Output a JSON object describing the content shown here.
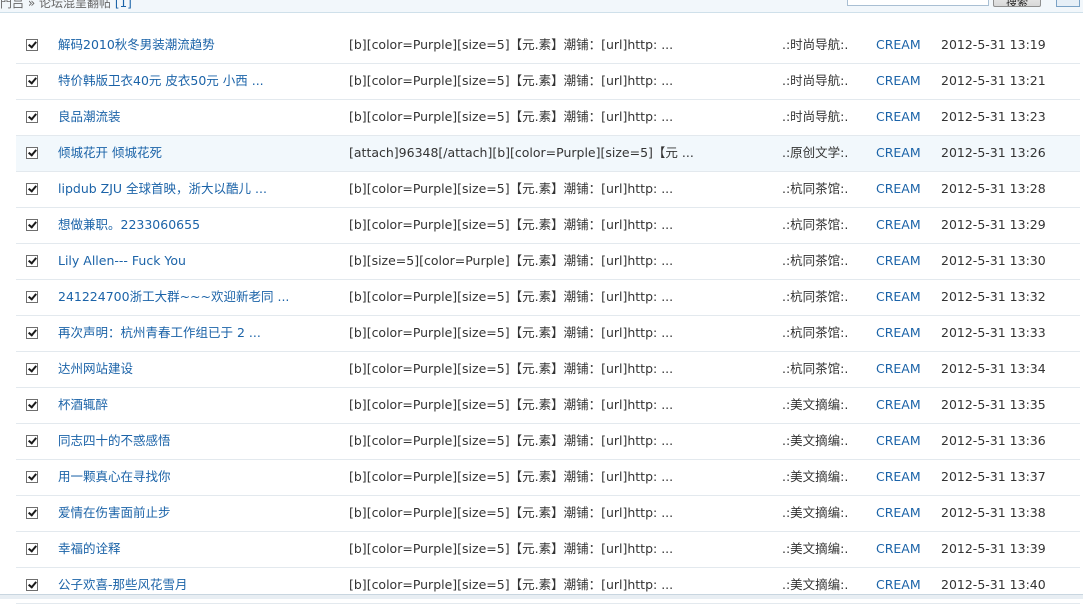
{
  "header": {
    "breadcrumb": "門吕 » 论坛混呈翻帖",
    "count_label": "[1]",
    "search_placeholder": "",
    "search_button": "搜索"
  },
  "posts": [
    {
      "title": "解码2010秋冬男装潮流趋势",
      "content": "[b][color=Purple][size=5]【元.素】潮铺：[url]http: ...",
      "forum": ".:时尚导航:.",
      "author": "CREAM",
      "date": "2012-5-31 13:19",
      "checked": true
    },
    {
      "title": "特价韩版卫衣40元 皮衣50元 小西 ...",
      "content": "[b][color=Purple][size=5]【元.素】潮铺：[url]http: ...",
      "forum": ".:时尚导航:.",
      "author": "CREAM",
      "date": "2012-5-31 13:21",
      "checked": true
    },
    {
      "title": "良品潮流装",
      "content": "[b][color=Purple][size=5]【元.素】潮铺：[url]http: ...",
      "forum": ".:时尚导航:.",
      "author": "CREAM",
      "date": "2012-5-31 13:23",
      "checked": true
    },
    {
      "title": "倾城花开 倾城花死",
      "content": "[attach]96348[/attach][b][color=Purple][size=5]【元 ...",
      "forum": ".:原创文学:.",
      "author": "CREAM",
      "date": "2012-5-31 13:26",
      "checked": true
    },
    {
      "title": "lipdub ZJU 全球首映，浙大以酷儿 ...",
      "content": "[b][color=Purple][size=5]【元.素】潮铺：[url]http: ...",
      "forum": ".:杭同茶馆:.",
      "author": "CREAM",
      "date": "2012-5-31 13:28",
      "checked": true
    },
    {
      "title": "想做兼职。2233060655",
      "content": "[b][color=Purple][size=5]【元.素】潮铺：[url]http: ...",
      "forum": ".:杭同茶馆:.",
      "author": "CREAM",
      "date": "2012-5-31 13:29",
      "checked": true
    },
    {
      "title": "Lily Allen--- Fuck You",
      "content": "[b][size=5][color=Purple]【元.素】潮铺：[url]http: ...",
      "forum": ".:杭同茶馆:.",
      "author": "CREAM",
      "date": "2012-5-31 13:30",
      "checked": true
    },
    {
      "title": "241224700浙工大群~~~欢迎新老同 ...",
      "content": "[b][color=Purple][size=5]【元.素】潮铺：[url]http: ...",
      "forum": ".:杭同茶馆:.",
      "author": "CREAM",
      "date": "2012-5-31 13:32",
      "checked": true
    },
    {
      "title": "再次声明：杭州青春工作组已于 2 ...",
      "content": "[b][color=Purple][size=5]【元.素】潮铺：[url]http: ...",
      "forum": ".:杭同茶馆:.",
      "author": "CREAM",
      "date": "2012-5-31 13:33",
      "checked": true
    },
    {
      "title": "达州网站建设",
      "content": "[b][color=Purple][size=5]【元.素】潮铺：[url]http: ...",
      "forum": ".:杭同茶馆:.",
      "author": "CREAM",
      "date": "2012-5-31 13:34",
      "checked": true
    },
    {
      "title": "杯酒辄醉",
      "content": "[b][color=Purple][size=5]【元.素】潮铺：[url]http: ...",
      "forum": ".:美文摘编:.",
      "author": "CREAM",
      "date": "2012-5-31 13:35",
      "checked": true
    },
    {
      "title": "同志四十的不惑感悟",
      "content": "[b][color=Purple][size=5]【元.素】潮铺：[url]http: ...",
      "forum": ".:美文摘编:.",
      "author": "CREAM",
      "date": "2012-5-31 13:36",
      "checked": true
    },
    {
      "title": "用一颗真心在寻找你",
      "content": "[b][color=Purple][size=5]【元.素】潮铺：[url]http: ...",
      "forum": ".:美文摘编:.",
      "author": "CREAM",
      "date": "2012-5-31 13:37",
      "checked": true
    },
    {
      "title": "爱情在伤害面前止步",
      "content": "[b][color=Purple][size=5]【元.素】潮铺：[url]http: ...",
      "forum": ".:美文摘编:.",
      "author": "CREAM",
      "date": "2012-5-31 13:38",
      "checked": true
    },
    {
      "title": "幸福的诠释",
      "content": "[b][color=Purple][size=5]【元.素】潮铺：[url]http: ...",
      "forum": ".:美文摘编:.",
      "author": "CREAM",
      "date": "2012-5-31 13:39",
      "checked": true
    },
    {
      "title": "公子欢喜-那些风花雪月",
      "content": "[b][color=Purple][size=5]【元.素】潮铺：[url]http: ...",
      "forum": ".:美文摘编:.",
      "author": "CREAM",
      "date": "2012-5-31 13:40",
      "checked": true
    }
  ],
  "highlighted_row": 3,
  "colors": {
    "link": "#1b63a8",
    "text": "#333333",
    "row_highlight": "#f2f8fc",
    "divider": "#e3e9ee"
  }
}
